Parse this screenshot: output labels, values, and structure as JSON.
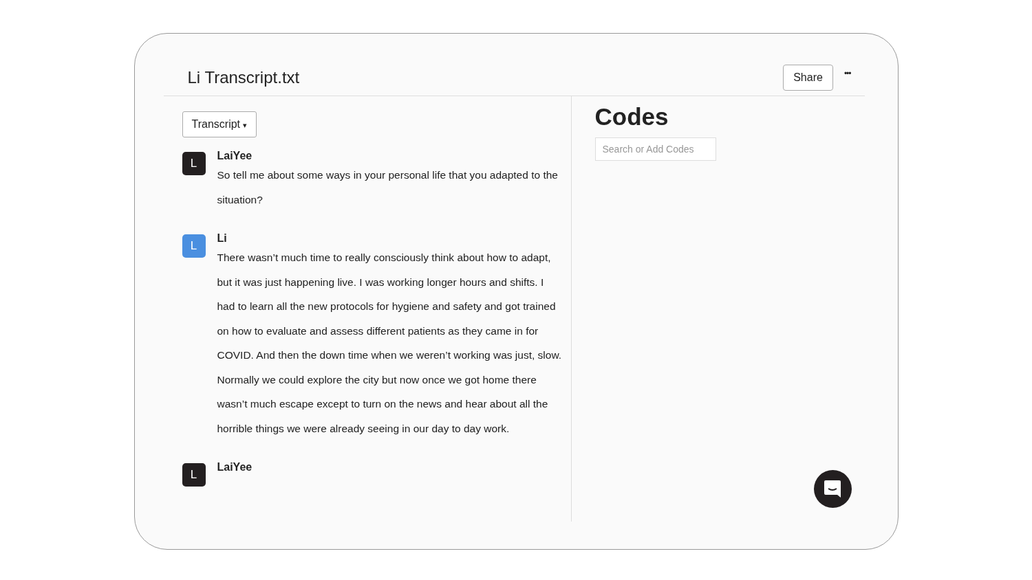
{
  "document": {
    "title": "Li Transcript.txt",
    "share_button": "Share",
    "more_button": "•••"
  },
  "view_dropdown": {
    "label": "Transcript",
    "caret": "▾"
  },
  "transcript": [
    {
      "initial": "L",
      "color": "#231f20",
      "speaker": "LaiYee",
      "text": "So tell me about some ways in your personal life that you adapted to the situation?"
    },
    {
      "initial": "L",
      "color": "#4a8fe0",
      "speaker": "Li",
      "text": "There wasn’t much time to really consciously think about how to adapt, but it was just happening live. I was working longer hours and shifts. I had to learn all the new protocols for hygiene and safety and got trained on how to evaluate and assess different patients as they came in for COVID. And then the down time when we weren’t working was just, slow. Normally we could explore the city but now once we got home there wasn’t much escape except to turn on the news and hear about all the horrible things we were already seeing in our day to day work."
    },
    {
      "initial": "L",
      "color": "#231f20",
      "speaker": "LaiYee"
    }
  ],
  "codes": {
    "title": "Codes",
    "search": {
      "placeholder": "Search or Add Codes"
    }
  }
}
